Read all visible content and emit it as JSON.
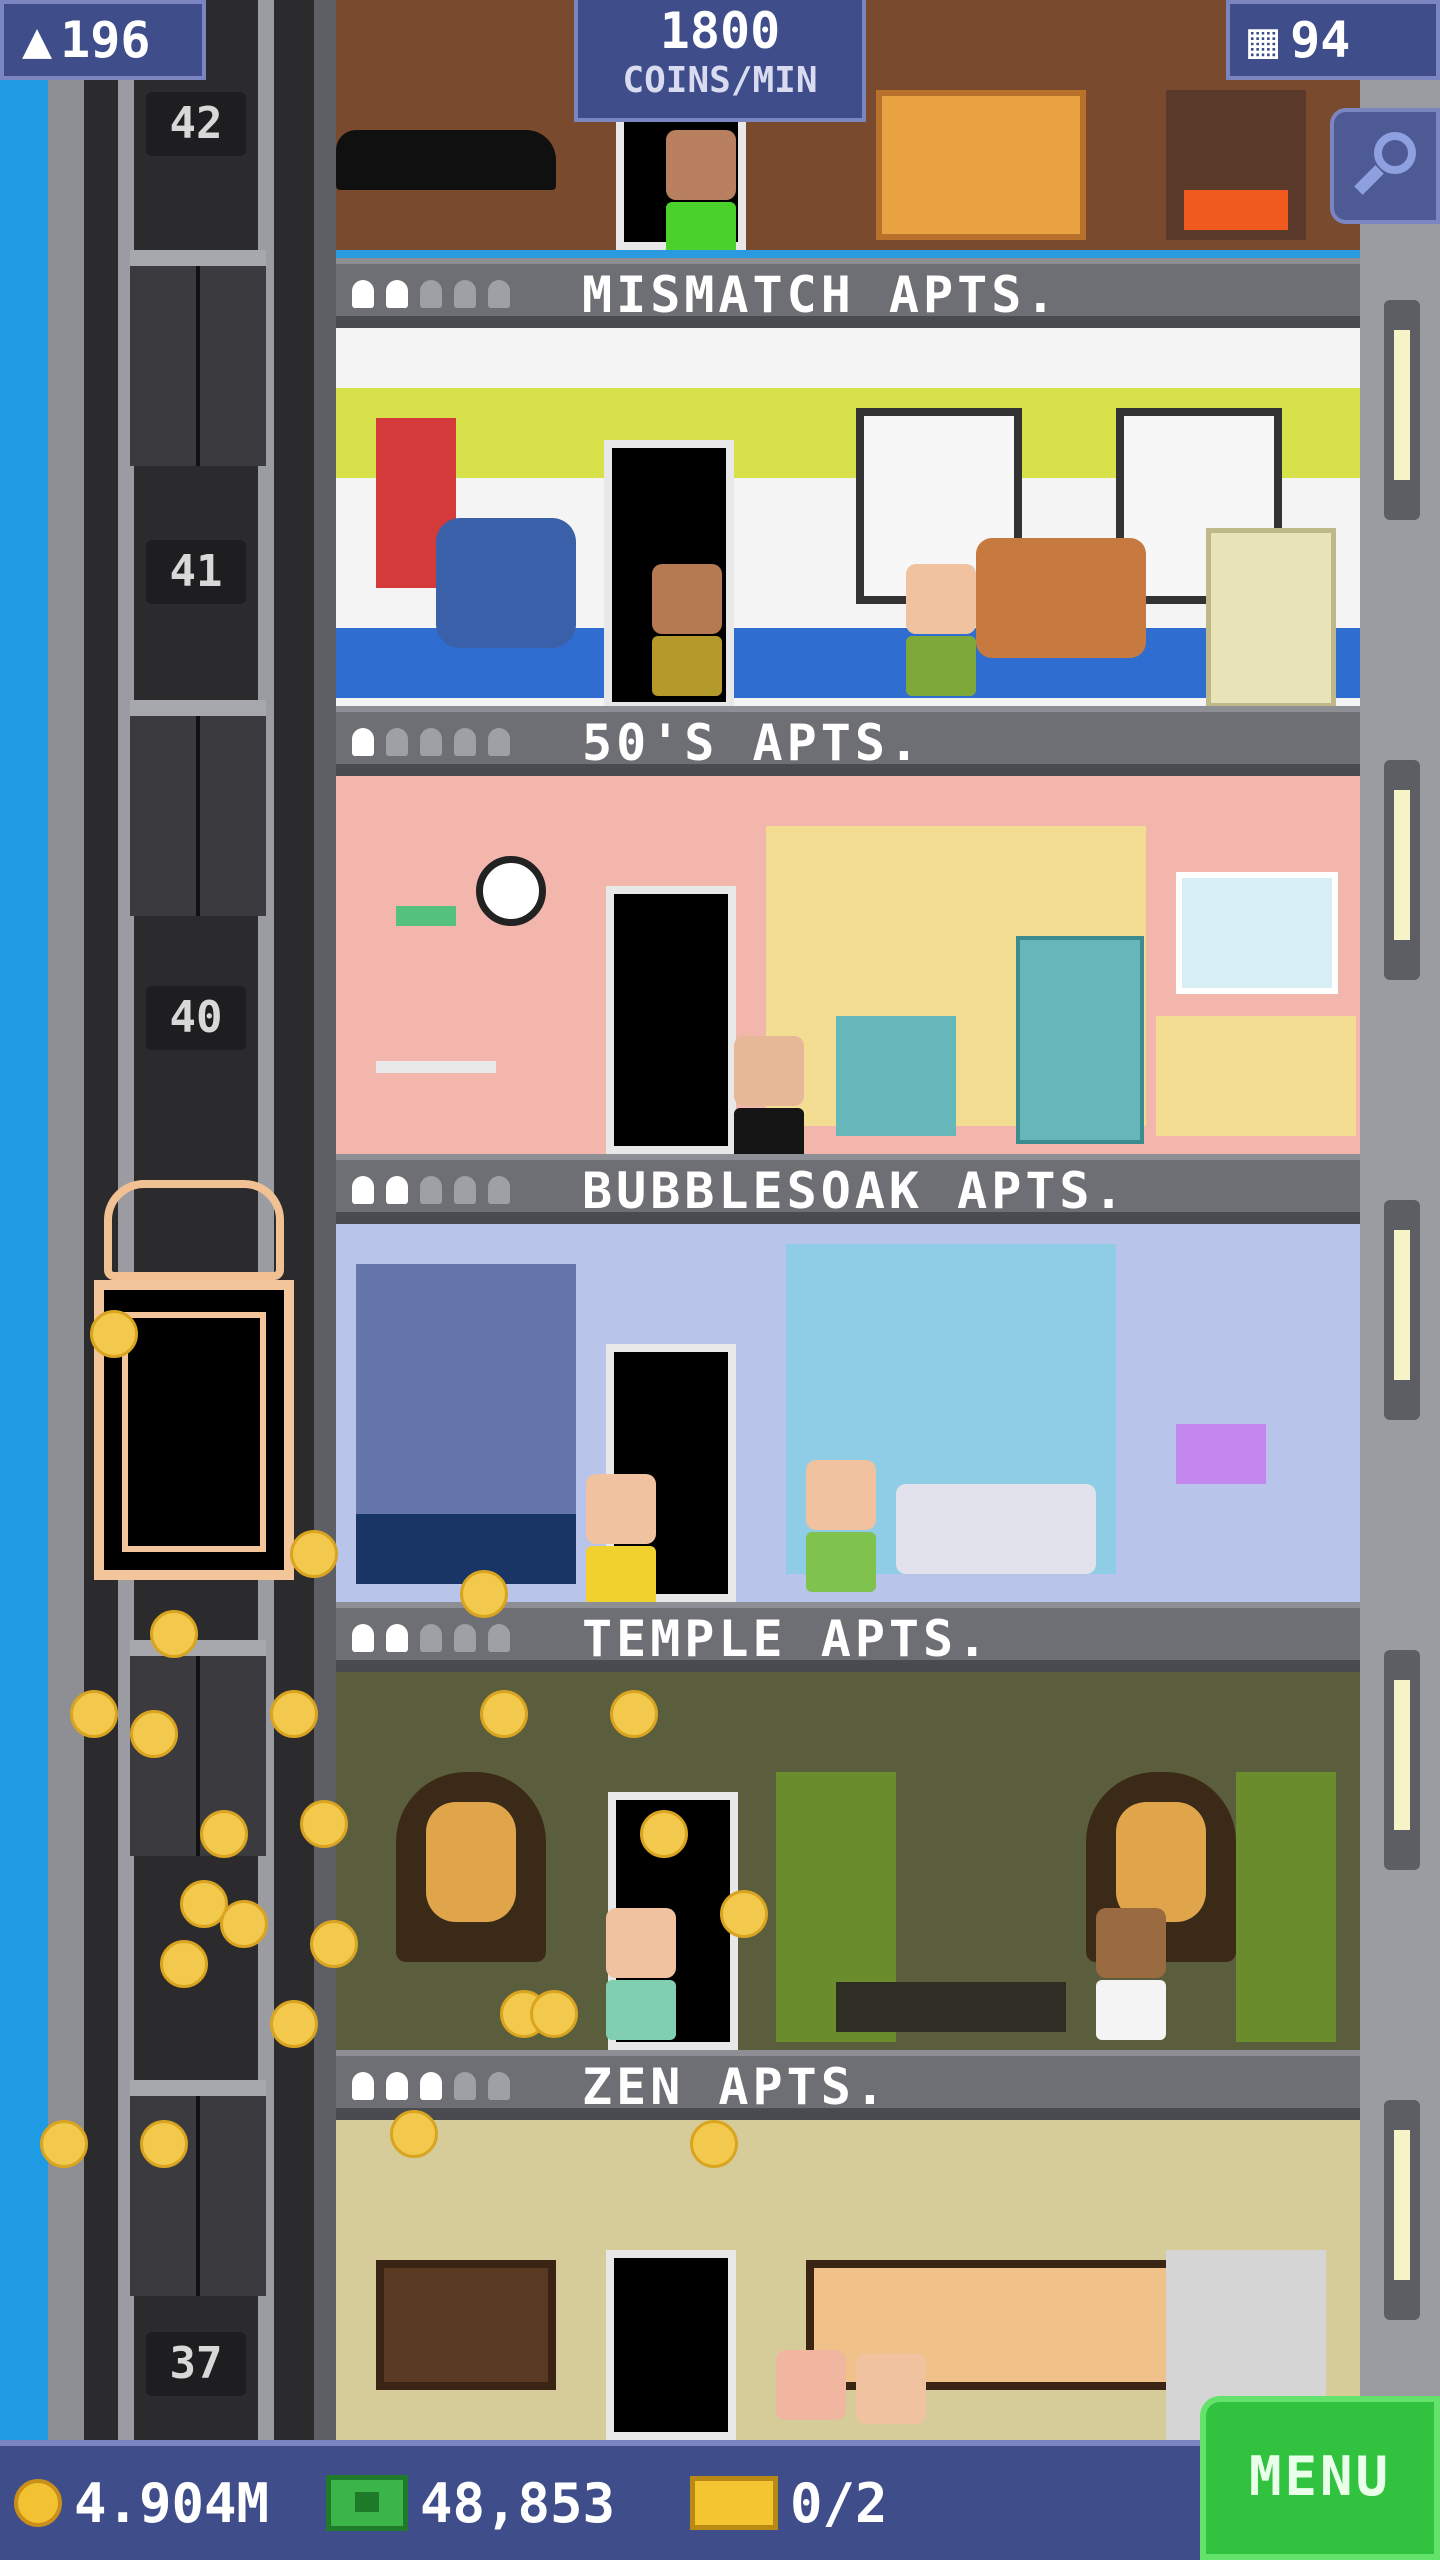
{
  "hud": {
    "population": "196",
    "coins_rate_value": "1800",
    "coins_rate_unit": "COINS/MIN",
    "floors_count": "94"
  },
  "elevator_shaft": {
    "floor_numbers": [
      "42",
      "41",
      "40",
      "37"
    ]
  },
  "floors": [
    {
      "name": "MISMATCH APTS.",
      "residents": 2,
      "capacity": 5
    },
    {
      "name": "50'S APTS.",
      "residents": 1,
      "capacity": 5
    },
    {
      "name": "BUBBLESOAK APTS.",
      "residents": 2,
      "capacity": 5
    },
    {
      "name": "TEMPLE APTS.",
      "residents": 2,
      "capacity": 5
    },
    {
      "name": "ZEN APTS.",
      "residents": 3,
      "capacity": 5
    }
  ],
  "bottom_bar": {
    "coins": "4.904M",
    "bux": "48,853",
    "tickets": "0/2",
    "menu_label": "MENU"
  },
  "colors": {
    "hud_bg": "#3f4d8a",
    "menu_green": "#31c23f",
    "coin_gold": "#f2c94c"
  }
}
